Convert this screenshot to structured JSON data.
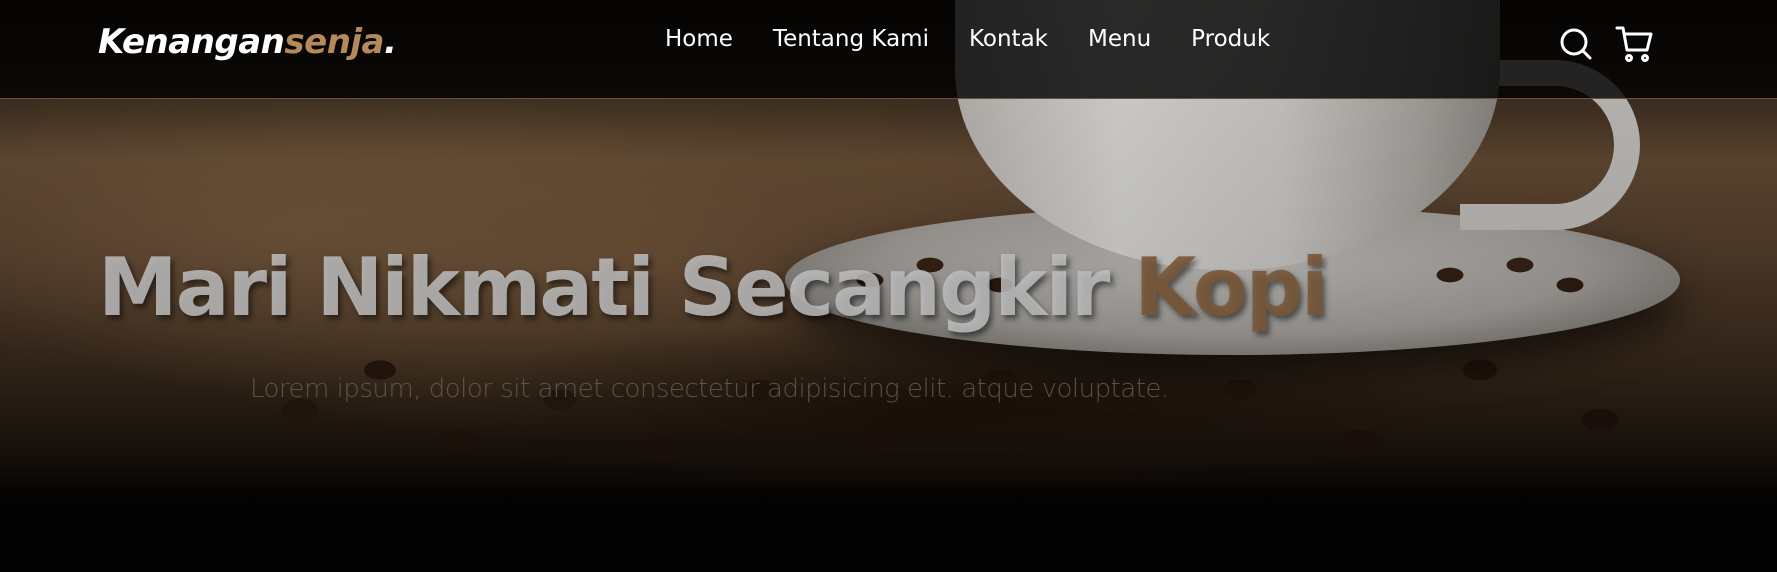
{
  "navbar": {
    "logo": {
      "main": "Kenangan",
      "accent": "senja",
      "dot": "."
    },
    "links": [
      {
        "label": "Home"
      },
      {
        "label": "Tentang Kami"
      },
      {
        "label": "Kontak"
      },
      {
        "label": "Menu"
      },
      {
        "label": "Produk"
      }
    ],
    "icons": [
      "search-icon",
      "shopping-cart-icon"
    ]
  },
  "hero": {
    "title_main": "Mari Nikmati Secangkir ",
    "title_accent": "Kopi",
    "description": "Lorem ipsum, dolor sit amet consectetur adipisicing elit. atque voluptate."
  },
  "colors": {
    "accent": "#b6895b",
    "navbar_bg": "#000000",
    "text_light": "#ffffff"
  }
}
